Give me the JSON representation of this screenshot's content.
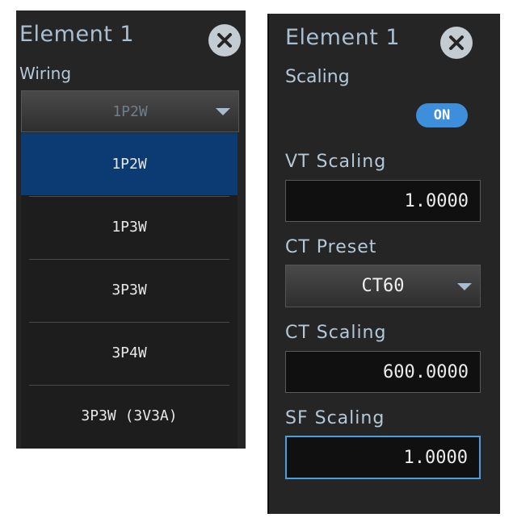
{
  "left_panel": {
    "title": "Element 1",
    "subtitle": "Wiring",
    "dropdown_value": "1P2W",
    "options": [
      "1P2W",
      "1P3W",
      "3P3W",
      "3P4W",
      "3P3W (3V3A)"
    ],
    "selected_option": "1P2W"
  },
  "right_panel": {
    "title": "Element 1",
    "scaling_label": "Scaling",
    "toggle_label": "ON",
    "vt_label": "VT  Scaling",
    "vt_value": "1.0000",
    "ct_preset_label": "CT  Preset",
    "ct_preset_value": "CT60",
    "ct_scaling_label": "CT  Scaling",
    "ct_scaling_value": "600.0000",
    "sf_label": "SF  Scaling",
    "sf_value": "1.0000"
  },
  "icons": {
    "close": "close-icon",
    "dropdown": "chevron-down-icon"
  },
  "colors": {
    "selected": "#0c3a73",
    "toggle_on": "#3d8fdc",
    "focus_border": "#4a9fe0",
    "panel_bg": "#252525"
  }
}
